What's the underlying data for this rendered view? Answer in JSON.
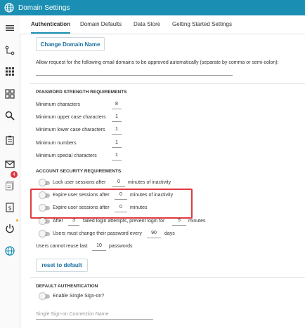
{
  "window": {
    "title": "Domain Settings"
  },
  "tabs": [
    {
      "label": "Authentication"
    },
    {
      "label": "Domain Defaults"
    },
    {
      "label": "Data Store"
    },
    {
      "label": "Getting Started Settings"
    }
  ],
  "sidebar": {
    "mail_badge": "4"
  },
  "domain": {
    "change_button": "Change Domain Name",
    "allow_label": "Allow request for the following email domains to be approved automatically (separate by comma or semi-colon):",
    "allow_value": ""
  },
  "password": {
    "heading": "PASSWORD STRENGTH REQUIREMENTS",
    "rows": [
      {
        "label": "Minimum characters",
        "value": "8"
      },
      {
        "label": "Minimum upper case characters",
        "value": "1"
      },
      {
        "label": "Minimum lower case characters",
        "value": "1"
      },
      {
        "label": "Minimum numbers",
        "value": "1"
      },
      {
        "label": "Minimum special characters",
        "value": "1"
      }
    ]
  },
  "security": {
    "heading": "ACCOUNT SECURITY REQUIREMENTS",
    "lock": {
      "before": "Lock user sessions after",
      "value": "0",
      "after": "minutes of inactivity"
    },
    "expire_inactive": {
      "before": "Expire user sessions after",
      "value": "0",
      "after": "minutes of inactivity"
    },
    "expire": {
      "before": "Expire user sessions after",
      "value": "0",
      "after": "minutes"
    },
    "failed": {
      "before": "After",
      "value1": "3",
      "middle": "failed login attempts, prevent login for",
      "value2": "5",
      "after": "minutes"
    },
    "change": {
      "before": "Users must change their password every",
      "value": "90",
      "after": "days"
    },
    "reuse": {
      "before": "Users cannot reuse last",
      "value": "10",
      "after": "passwords"
    },
    "reset_button": "reset to default"
  },
  "default_auth": {
    "heading": "DEFAULT AUTHENTICATION",
    "sso_label": "Enable Single Sign-on?",
    "sso_placeholder": "Single Sign-on Connection Name"
  }
}
